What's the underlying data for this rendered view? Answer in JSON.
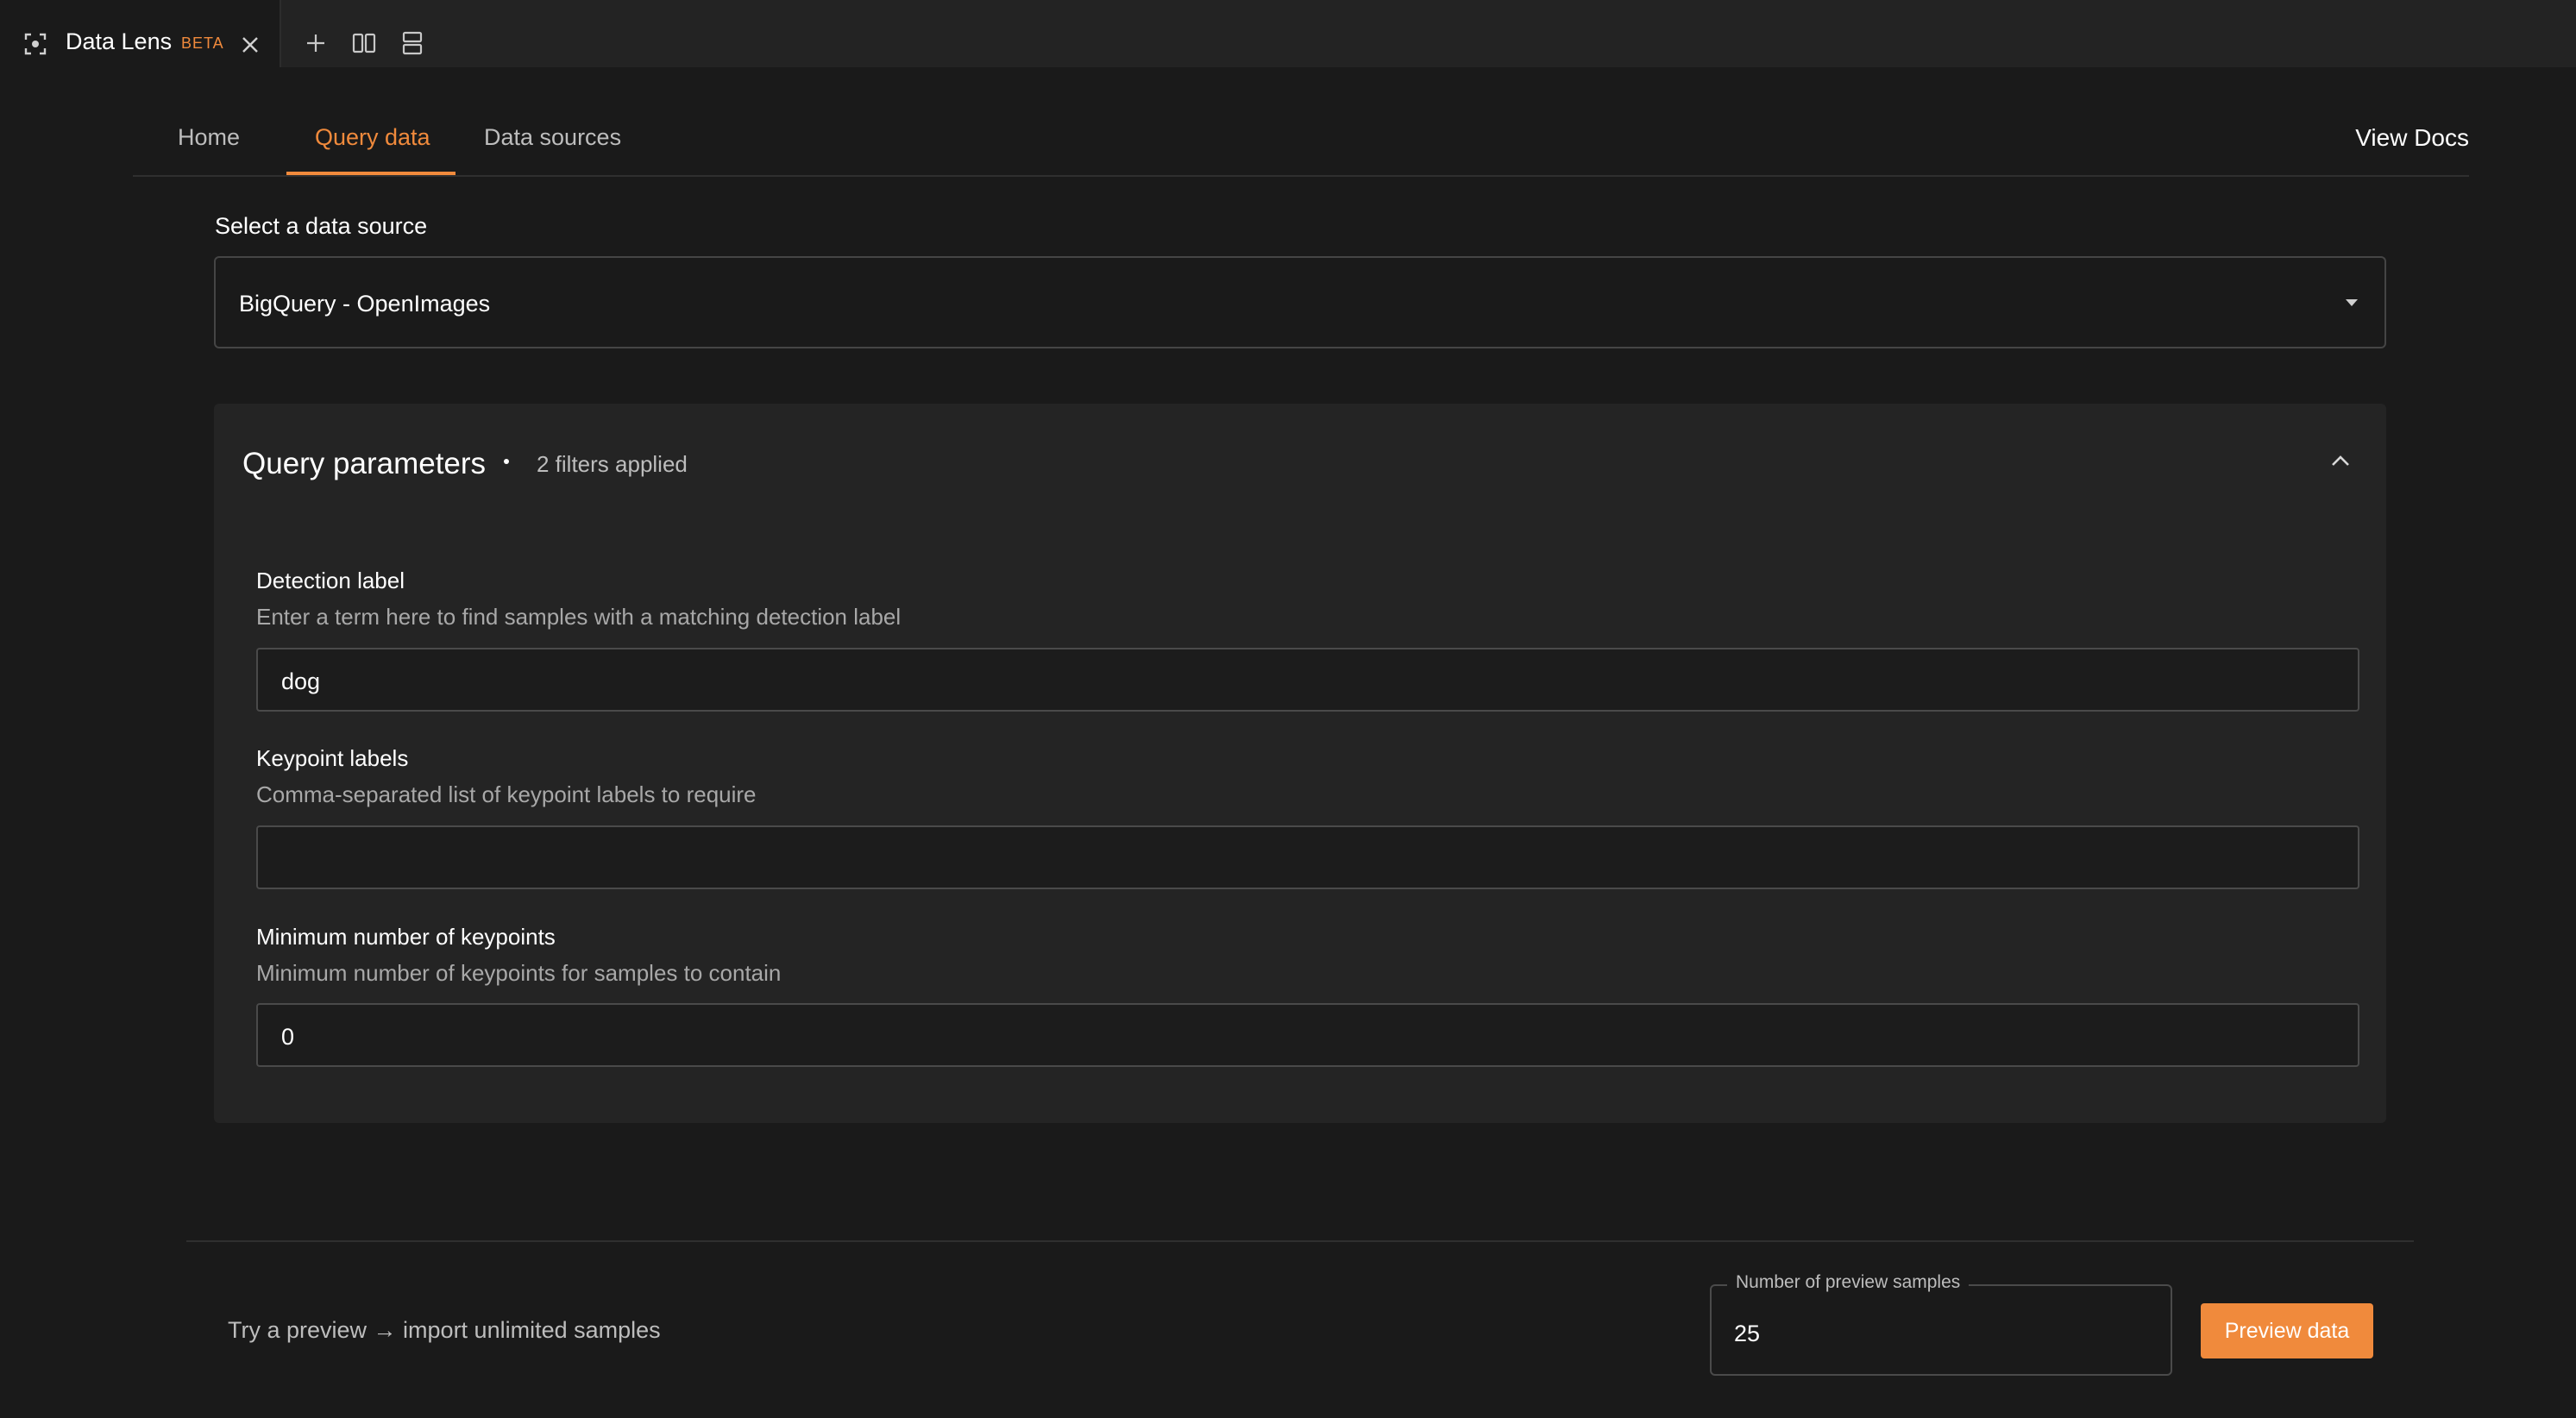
{
  "tab": {
    "title": "Data Lens",
    "badge": "BETA"
  },
  "nav": {
    "tabs": [
      {
        "label": "Home"
      },
      {
        "label": "Query data"
      },
      {
        "label": "Data sources"
      }
    ],
    "active": "Query data",
    "view_docs": "View Docs"
  },
  "data_source": {
    "label": "Select a data source",
    "selected": "BigQuery - OpenImages"
  },
  "query_parameters": {
    "title": "Query parameters",
    "filters_applied": "2 filters applied",
    "fields": [
      {
        "label": "Detection label",
        "help": "Enter a term here to find samples with a matching detection label",
        "value": "dog"
      },
      {
        "label": "Keypoint labels",
        "help": "Comma-separated list of keypoint labels to require",
        "value": ""
      },
      {
        "label": "Minimum number of keypoints",
        "help": "Minimum number of keypoints for samples to contain",
        "value": "0"
      }
    ]
  },
  "footer": {
    "note": "Try a preview → import unlimited samples",
    "samples_label": "Number of preview samples",
    "samples_value": "25",
    "preview_button": "Preview data"
  },
  "colors": {
    "accent": "#f08a3c",
    "background": "#1a1a1a",
    "panel": "#242424"
  },
  "icons": [
    "scan-icon",
    "close-icon",
    "plus-icon",
    "split-vertical-icon",
    "split-horizontal-icon",
    "chevron-down-icon",
    "chevron-up-icon"
  ]
}
